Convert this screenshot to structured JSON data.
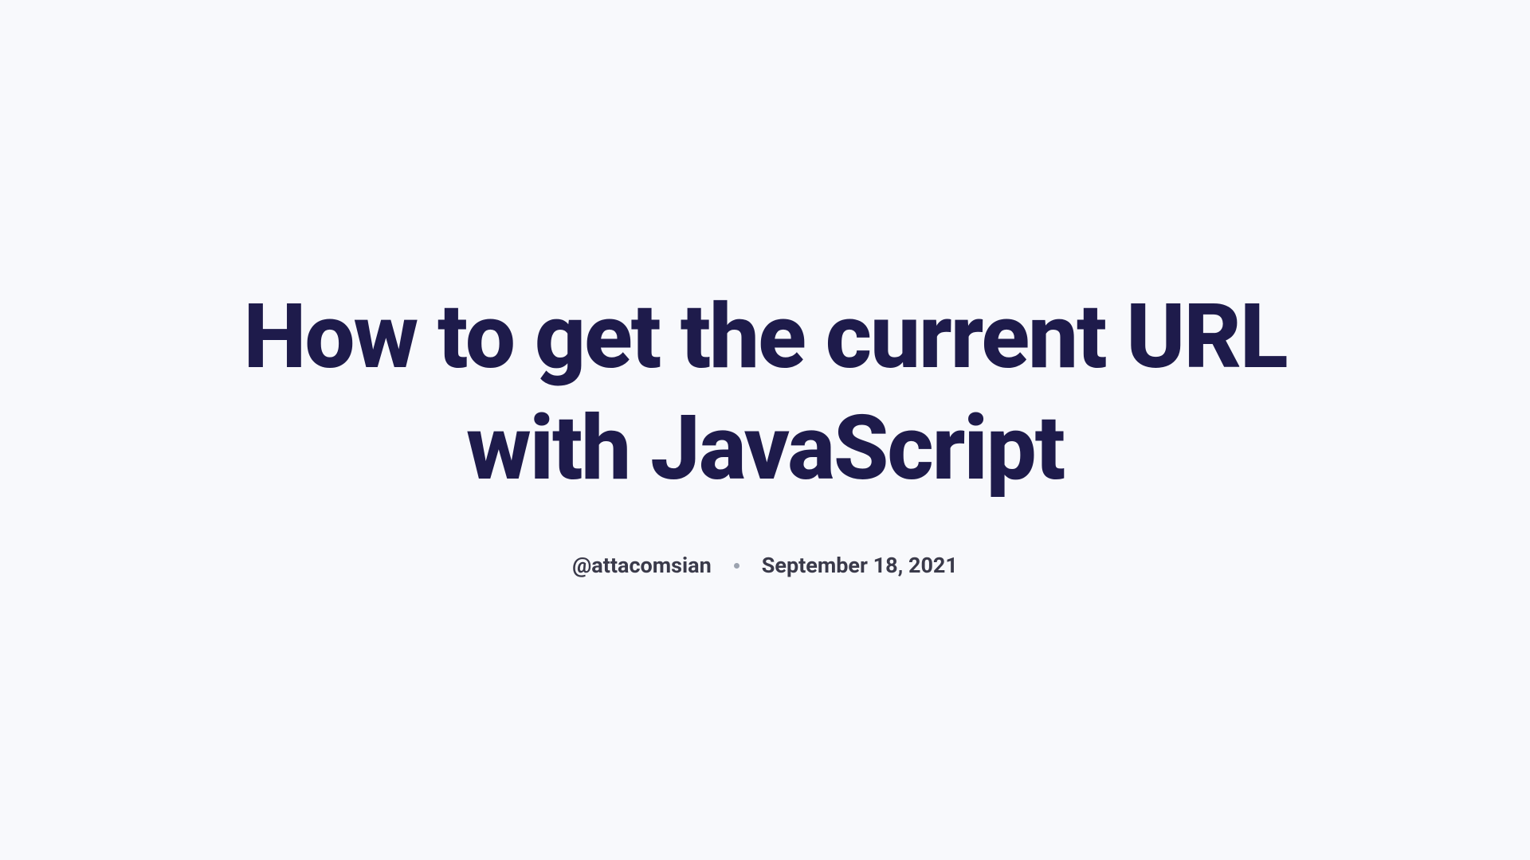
{
  "article": {
    "title": "How to get the current URL with JavaScript",
    "author": "@attacomsian",
    "date": "September 18, 2021"
  }
}
